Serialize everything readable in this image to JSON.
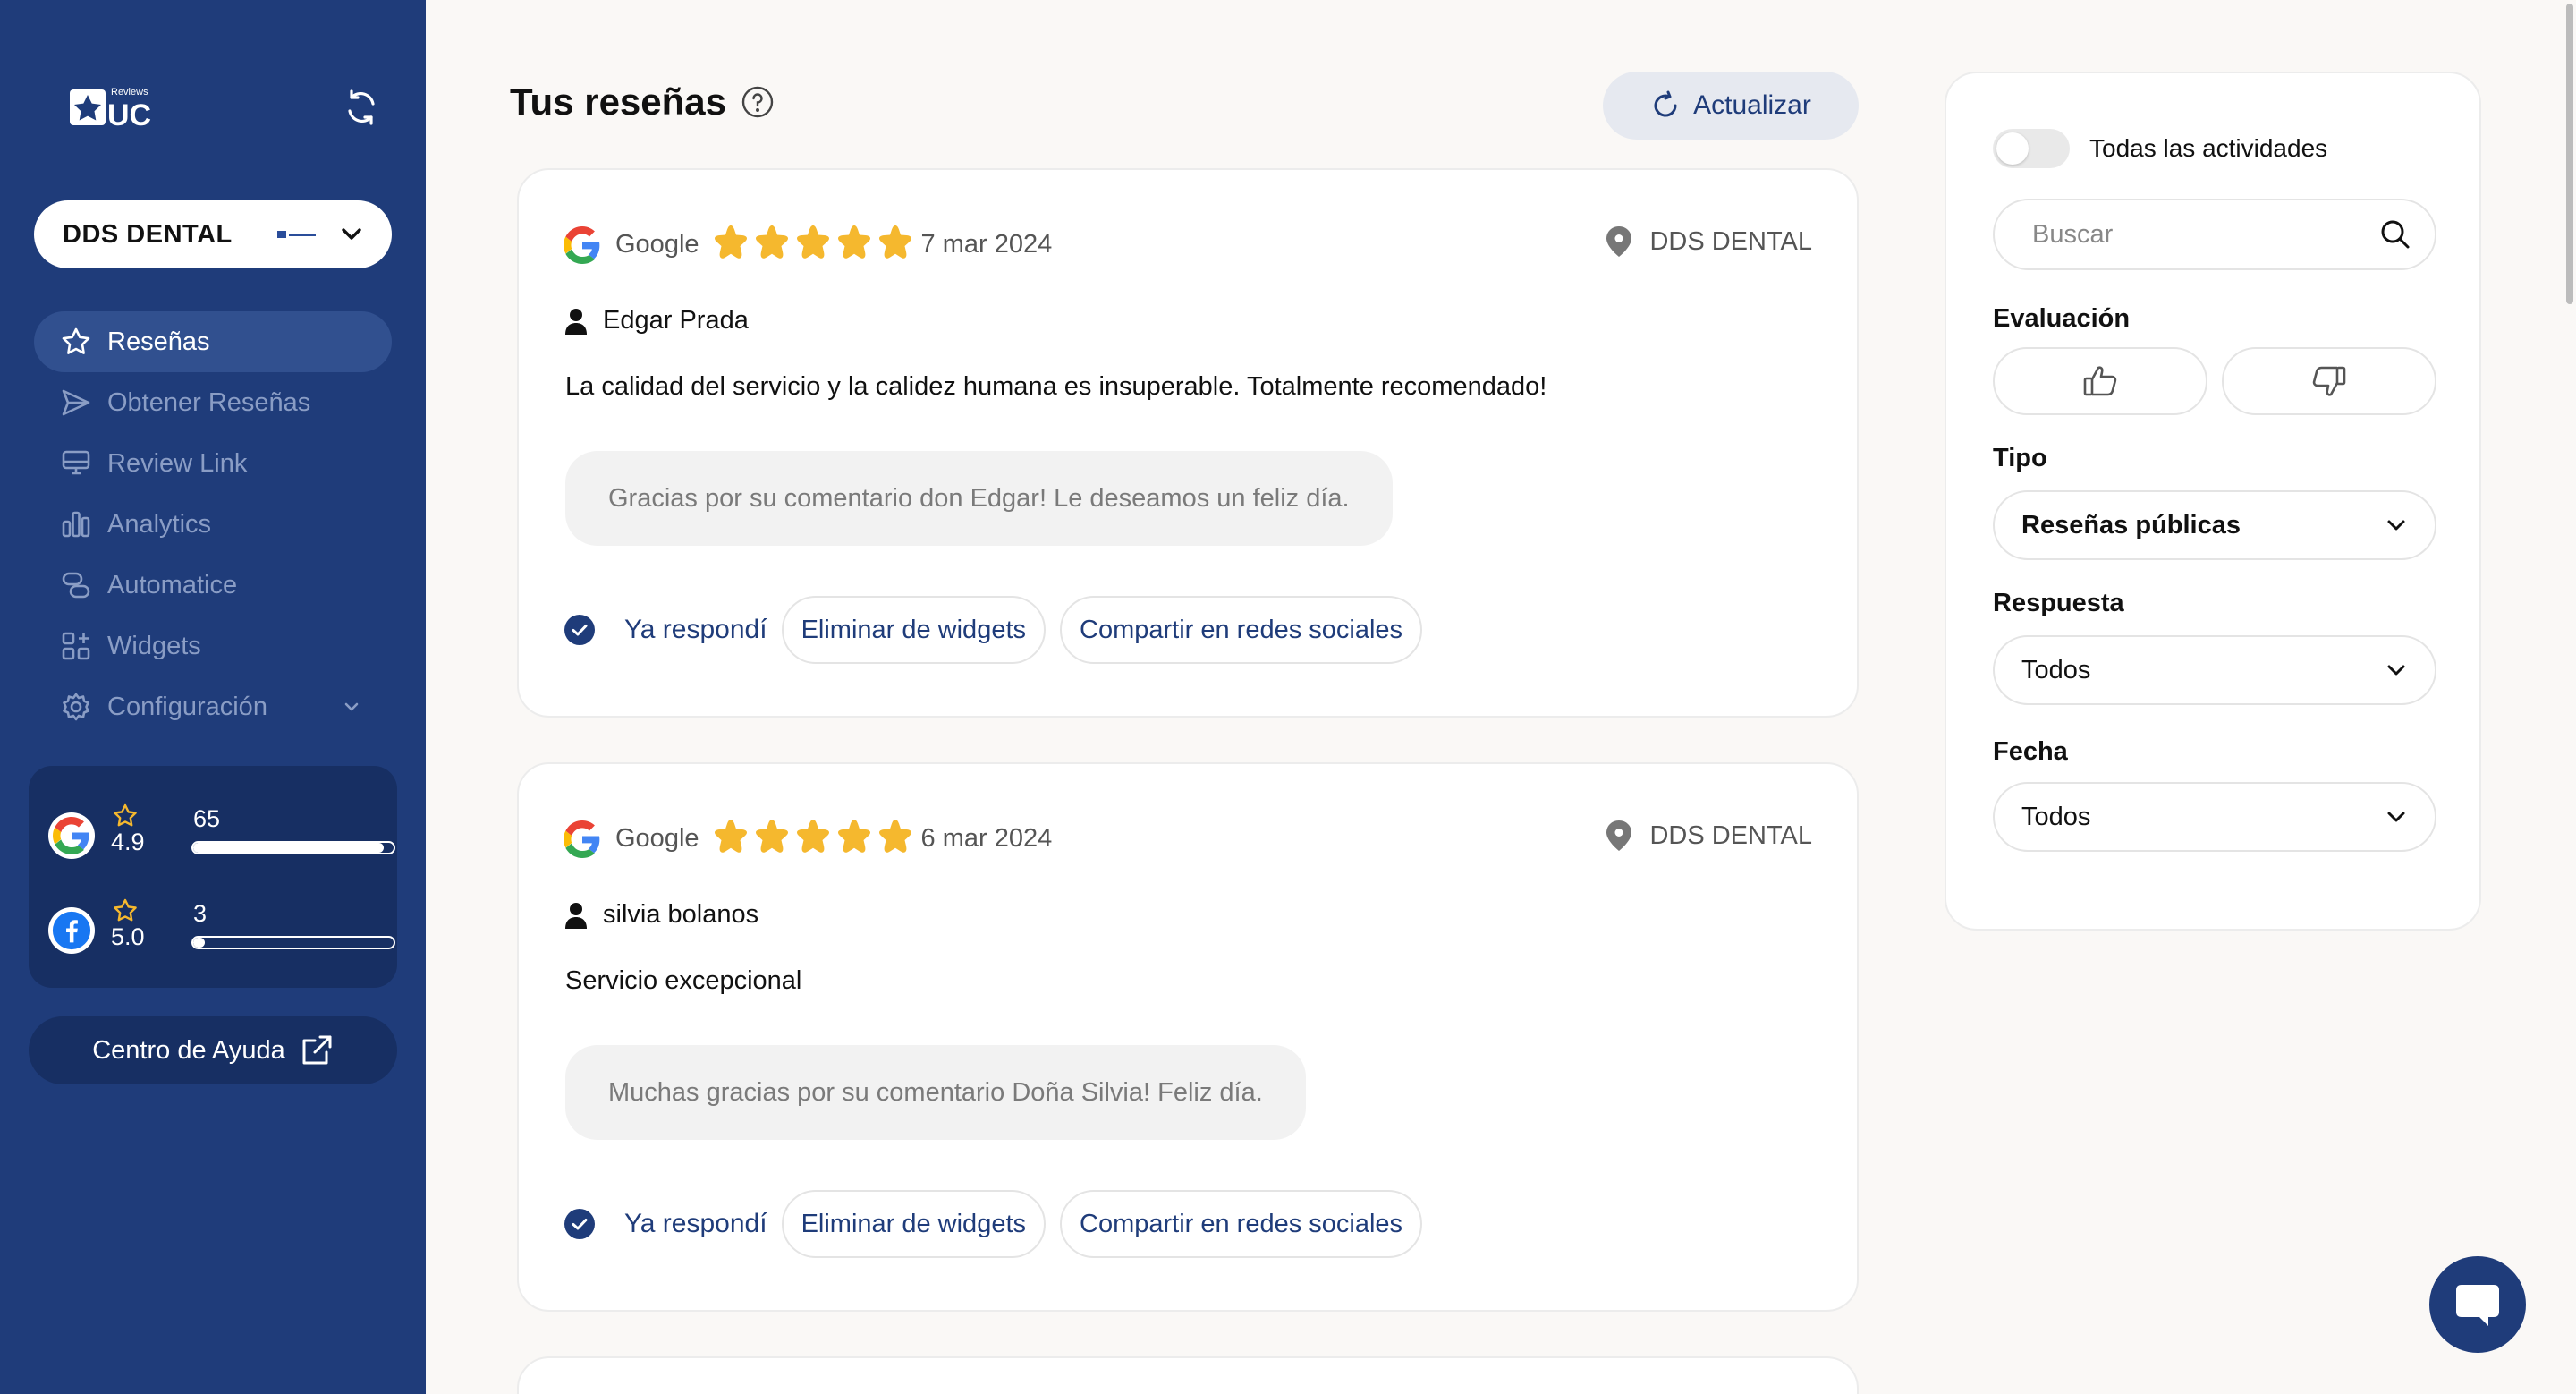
{
  "sidebar": {
    "logo_text": "UC",
    "logo_small": "Reviews",
    "business": "DDS DENTAL",
    "nav": [
      {
        "label": "Reseñas",
        "icon": "star-icon",
        "active": true
      },
      {
        "label": "Obtener Reseñas",
        "icon": "send-icon"
      },
      {
        "label": "Review Link",
        "icon": "monitor-icon"
      },
      {
        "label": "Analytics",
        "icon": "bar-chart-icon"
      },
      {
        "label": "Automatice",
        "icon": "link-icon"
      },
      {
        "label": "Widgets",
        "icon": "widgets-icon"
      },
      {
        "label": "Configuración",
        "icon": "gear-icon"
      }
    ],
    "ratings": [
      {
        "platform": "Google",
        "score": "4.9",
        "count": "65",
        "fill": 0.95
      },
      {
        "platform": "Facebook",
        "score": "5.0",
        "count": "3",
        "fill": 0.04
      }
    ],
    "help": "Centro de Ayuda"
  },
  "header": {
    "title": "Tus reseñas",
    "refresh": "Actualizar"
  },
  "reviews": [
    {
      "source": "Google",
      "rating": 5,
      "date": "7 mar 2024",
      "location": "DDS DENTAL",
      "author": "Edgar Prada",
      "text": "La calidad del servicio y la calidez humana es insuperable. Totalmente recomendado!",
      "reply": "Gracias por su comentario don Edgar! Le deseamos un feliz día.",
      "replied_label": "Ya respondí",
      "remove_label": "Eliminar de widgets",
      "share_label": "Compartir en redes sociales"
    },
    {
      "source": "Google",
      "rating": 5,
      "date": "6 mar 2024",
      "location": "DDS DENTAL",
      "author": "silvia bolanos",
      "text": "Servicio excepcional",
      "reply": "Muchas gracias por su comentario Doña Silvia! Feliz día.",
      "replied_label": "Ya respondí",
      "remove_label": "Eliminar de widgets",
      "share_label": "Compartir en redes sociales"
    }
  ],
  "filters": {
    "all_activities": "Todas las actividades",
    "search_placeholder": "Buscar",
    "evaluation_label": "Evaluación",
    "type_label": "Tipo",
    "type_value": "Reseñas públicas",
    "response_label": "Respuesta",
    "response_value": "Todos",
    "date_label": "Fecha",
    "date_value": "Todos"
  },
  "colors": {
    "sidebar": "#1f3c7a",
    "accent": "#1f3c7a",
    "star": "#f5b82e",
    "background": "#faf8f6"
  }
}
